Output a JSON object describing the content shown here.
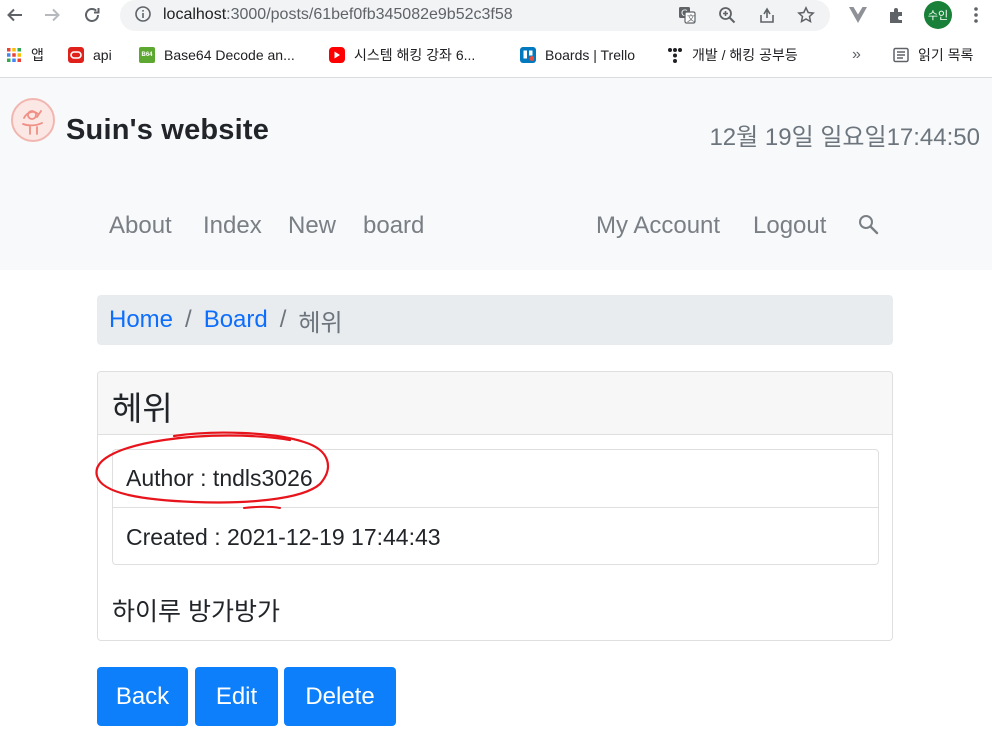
{
  "browser": {
    "url_host": "localhost",
    "url_rest": ":3000/posts/61bef0fb345082e9b52c3f58",
    "profile_label": "수인"
  },
  "bookmarks": {
    "items": [
      {
        "label": "앱",
        "icon": "apps-grid-icon",
        "color": "#ea4335"
      },
      {
        "label": "api",
        "icon": "oracle-icon",
        "color": "#e0201b"
      },
      {
        "label": "Base64 Decode an...",
        "icon": "b64-icon",
        "color": "#5da831",
        "badge": "B64"
      },
      {
        "label": "시스템 해킹 강좌 6...",
        "icon": "youtube-icon",
        "color": "#ff0000"
      },
      {
        "label": "Boards | Trello",
        "icon": "trello-icon",
        "color": "#0079bf"
      },
      {
        "label": "개발 / 해킹 공부등",
        "icon": "tistory-icon",
        "color": "#202124"
      },
      {
        "label": "읽기 목록",
        "icon": "reading-list-icon",
        "color": "#5f6368"
      }
    ],
    "more": "»"
  },
  "site": {
    "brand": "Suin's website",
    "clock": "12월 19일 일요일17:44:50",
    "nav_left": [
      "About",
      "Index",
      "New",
      "board"
    ],
    "nav_right": [
      "My Account",
      "Logout"
    ]
  },
  "breadcrumb": {
    "home": "Home",
    "board": "Board",
    "current": "헤위",
    "separator": "/"
  },
  "post": {
    "title": "헤위",
    "author_line": "Author : tndls3026",
    "created_line": "Created : 2021-12-19 17:44:43",
    "body": "하이루 방가방가"
  },
  "actions": {
    "back": "Back",
    "edit": "Edit",
    "delete": "Delete"
  },
  "colors": {
    "primary": "#0d7ffb",
    "link": "#0d6efd",
    "annotation": "#e8141c"
  }
}
